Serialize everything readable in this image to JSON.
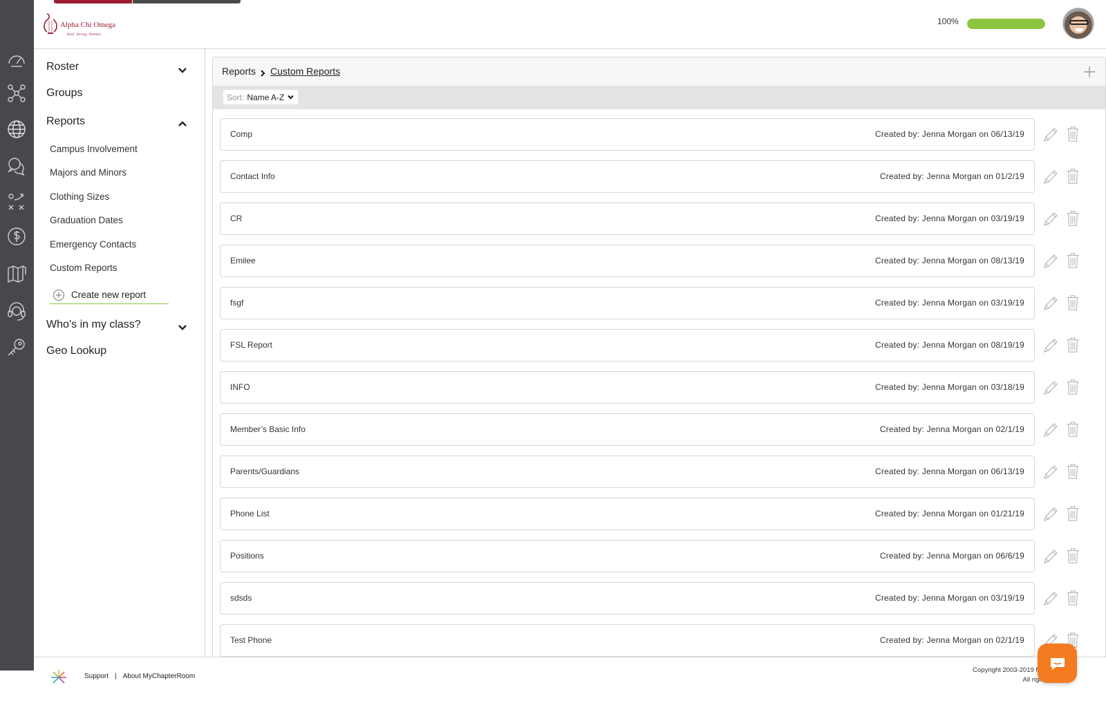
{
  "app": {
    "brand_name": "Alpha Chi Omega",
    "brand_tagline": "Real. Strong. Women.",
    "progress_label": "100%",
    "progress_value": 1.0,
    "colors": {
      "brand": "#9b1b30",
      "accent_green": "#8cc63f",
      "rail_bg": "#47484b",
      "chat_orange": "#f47b20"
    }
  },
  "rail": {
    "icons": [
      "dashboard-icon",
      "network-icon",
      "globe-icon",
      "chat-bubbles-icon",
      "strategy-icon",
      "dollar-icon",
      "library-icon",
      "support-headset-icon",
      "key-icon"
    ]
  },
  "sidenav": {
    "roster": "Roster",
    "groups": "Groups",
    "reports": "Reports",
    "report_items": [
      "Campus Involvement",
      "Majors and Minors",
      "Clothing Sizes",
      "Graduation Dates",
      "Emergency Contacts",
      "Custom Reports"
    ],
    "create_new": "Create new report",
    "whos_in_class": "Who’s in my class?",
    "geo_lookup": "Geo Lookup"
  },
  "main": {
    "breadcrumb_root": "Reports",
    "breadcrumb_current": "Custom Reports",
    "sort_label": "Sort:",
    "sort_value": "Name A-Z",
    "reports": [
      {
        "name": "Comp",
        "created": "Created by:  Jenna Morgan on 06/13/19"
      },
      {
        "name": "Contact Info",
        "created": "Created by:  Jenna Morgan on 01/2/19"
      },
      {
        "name": "CR",
        "created": "Created by:  Jenna Morgan on 03/19/19"
      },
      {
        "name": "Emilee",
        "created": "Created by:  Jenna Morgan on 08/13/19"
      },
      {
        "name": "fsgf",
        "created": "Created by:  Jenna Morgan on 03/19/19"
      },
      {
        "name": "FSL Report",
        "created": "Created by:  Jenna Morgan on 08/19/19"
      },
      {
        "name": "INFO",
        "created": "Created by:  Jenna Morgan on 03/18/19"
      },
      {
        "name": "Member’s Basic Info",
        "created": "Created by:  Jenna Morgan on 02/1/19"
      },
      {
        "name": "Parents/Guardians",
        "created": "Created by:  Jenna Morgan on 06/13/19"
      },
      {
        "name": "Phone List",
        "created": "Created by:  Jenna Morgan on 01/21/19"
      },
      {
        "name": "Positions",
        "created": "Created by:  Jenna Morgan on 06/6/19"
      },
      {
        "name": "sdsds",
        "created": "Created by:  Jenna Morgan on 03/19/19"
      },
      {
        "name": "Test Phone",
        "created": "Created by:  Jenna Morgan on 02/1/19"
      }
    ]
  },
  "footer": {
    "support": "Support",
    "divider": "|",
    "about": "About MyChapterRoom",
    "copyright_line1": "Copyright 2003-2019 MyChapter",
    "copyright_line2": "All rights r... ed."
  }
}
